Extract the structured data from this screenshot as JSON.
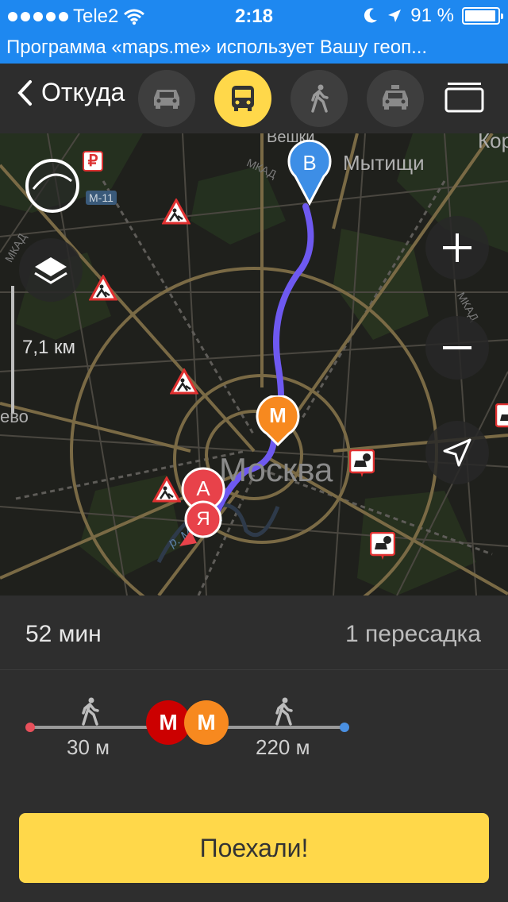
{
  "status_bar": {
    "carrier": "Tele2",
    "time": "2:18",
    "battery": "91 %"
  },
  "banner": {
    "text": "Программа «maps.me» использует Вашу геоп..."
  },
  "toolbar": {
    "back_label": "Откуда",
    "modes": [
      {
        "name": "car",
        "icon": "car-icon",
        "active": false
      },
      {
        "name": "transit",
        "icon": "bus-icon",
        "active": true
      },
      {
        "name": "walk",
        "icon": "walk-icon",
        "active": false
      },
      {
        "name": "taxi",
        "icon": "taxi-icon",
        "active": false
      }
    ],
    "menu_icon": "stack-icon"
  },
  "map": {
    "labels": {
      "veshki": "Вешки",
      "mytishchi": "Мытищи",
      "kor": "Кор",
      "moscow": "Москва",
      "evo": "ево",
      "river": "р. Москва",
      "mkad": "МКАД",
      "m11": "М-11"
    },
    "scale": "7,1 км",
    "markers": {
      "start": "А",
      "end": "В",
      "ya": "Я",
      "metro": "М"
    },
    "route_color": "#6e59f0",
    "controls": [
      "compass-icon",
      "layers-icon",
      "zoom-in-icon",
      "zoom-out-icon",
      "location-arrow-icon"
    ]
  },
  "summary": {
    "duration": "52 мин",
    "transfers": "1 пересадка"
  },
  "timeline": {
    "walk_start": "30 м",
    "walk_end": "220 м",
    "metro_letter": "М",
    "metro_colors": [
      "#cc0000",
      "#f7891f"
    ],
    "start_color": "#e8505b",
    "end_color": "#4a90e2"
  },
  "go_button": {
    "label": "Поехали!"
  }
}
